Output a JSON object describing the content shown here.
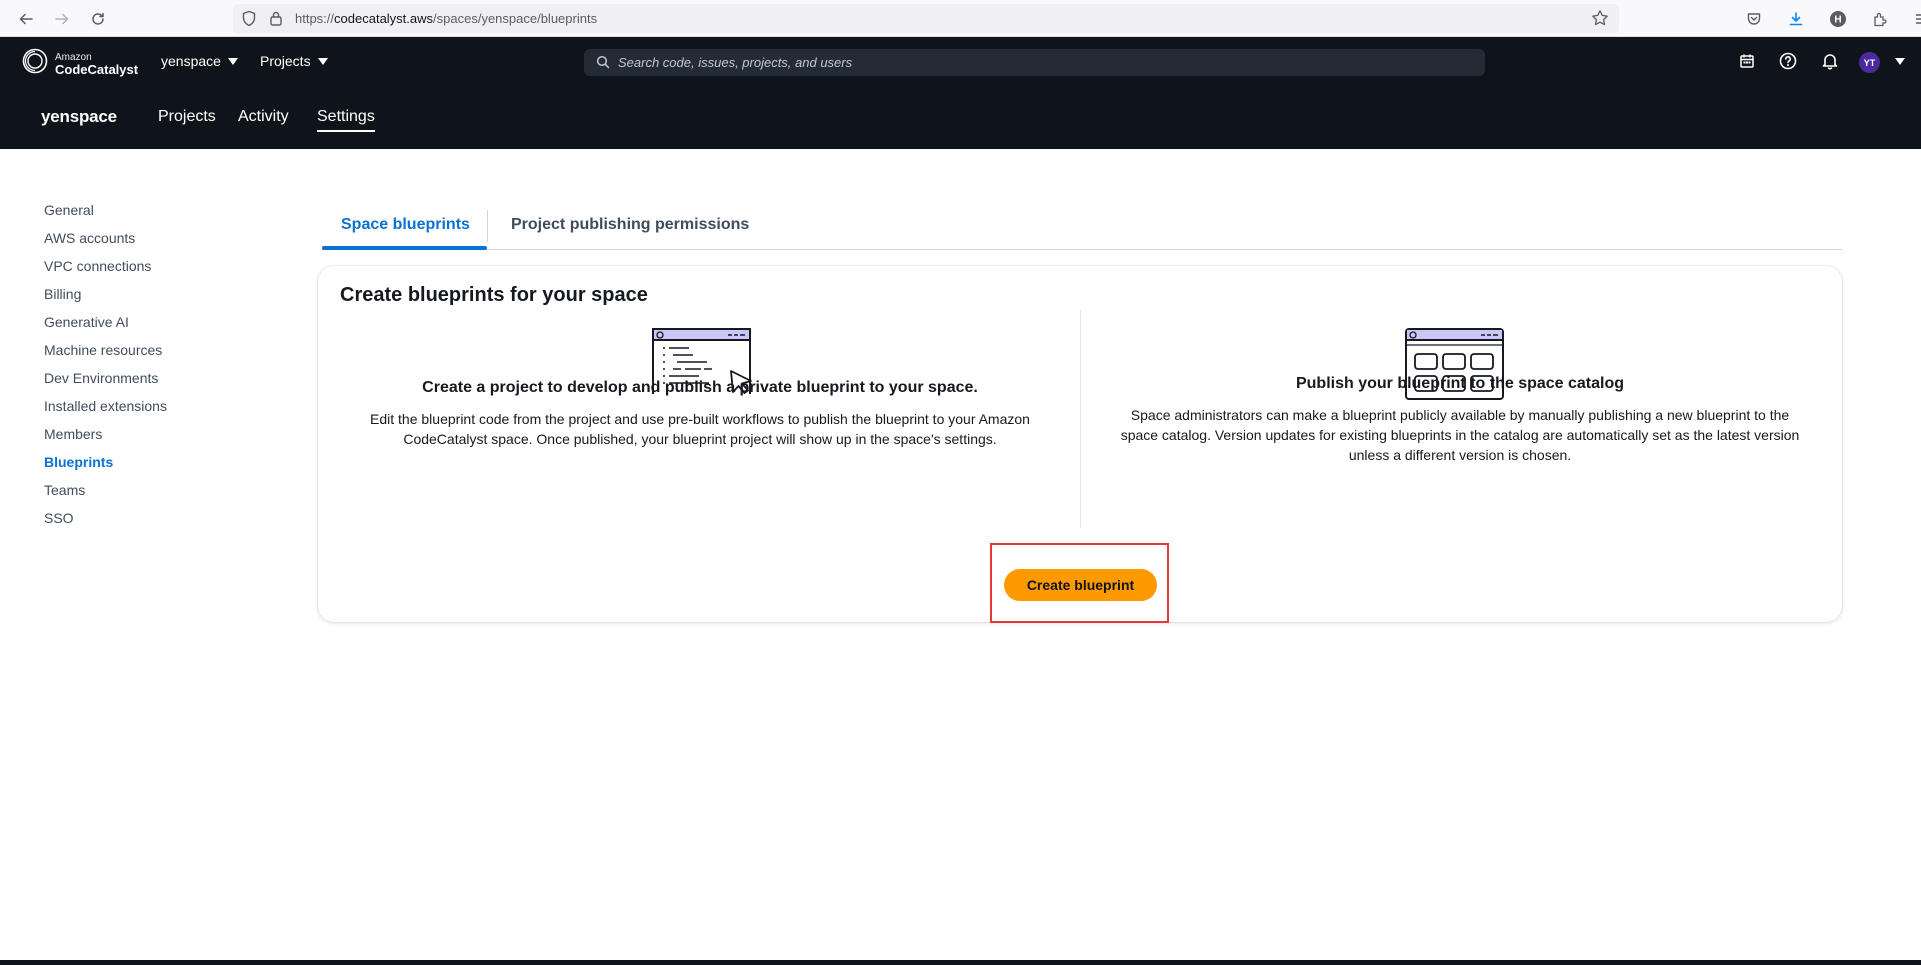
{
  "browser": {
    "url_prefix": "https://",
    "url_host": "codecatalyst.aws",
    "url_path": "/spaces/yenspace/blueprints"
  },
  "app": {
    "logo_small": "Amazon",
    "logo_big": "CodeCatalyst",
    "space_dropdown": "yenspace",
    "projects_dropdown": "Projects",
    "search_placeholder": "Search code, issues, projects, and users",
    "avatar_initials": "YT"
  },
  "space_nav": {
    "name": "yenspace",
    "links": [
      "Projects",
      "Activity",
      "Settings"
    ],
    "active": "Settings"
  },
  "sidebar": {
    "items": [
      {
        "label": "General"
      },
      {
        "label": "AWS accounts"
      },
      {
        "label": "VPC connections"
      },
      {
        "label": "Billing"
      },
      {
        "label": "Generative AI"
      },
      {
        "label": "Machine resources"
      },
      {
        "label": "Dev Environments"
      },
      {
        "label": "Installed extensions"
      },
      {
        "label": "Members"
      },
      {
        "label": "Blueprints"
      },
      {
        "label": "Teams"
      },
      {
        "label": "SSO"
      }
    ],
    "active": "Blueprints"
  },
  "tabs": {
    "items": [
      "Space blueprints",
      "Project publishing permissions"
    ],
    "active": "Space blueprints"
  },
  "card": {
    "title": "Create blueprints for your space",
    "left": {
      "heading": "Create a project to develop and publish a private blueprint to your space.",
      "body_line1": "Edit the blueprint code from the project and use pre-built workflows to publish the blueprint to your Amazon",
      "body_line2": "CodeCatalyst space. Once published, your blueprint project will show up in the space's settings."
    },
    "right": {
      "heading": "Publish your blueprint to the space catalog",
      "body_line1": "Space administrators can make a blueprint publicly available by manually publishing a new blueprint to the",
      "body_line2": "space catalog. Version updates for existing blueprints in the catalog are automatically set as the latest version",
      "body_line3": "unless a different version is chosen."
    },
    "create_button": "Create blueprint"
  },
  "colors": {
    "accent": "#0972d3",
    "primary_button": "#ff9900",
    "header_bg": "#0f141a",
    "highlight_box": "#e53935",
    "avatar_bg": "#4b2a9e"
  },
  "icons": [
    "back-icon",
    "forward-icon",
    "reload-icon",
    "shield-icon",
    "lock-icon",
    "bookmark-star-icon",
    "pocket-icon",
    "download-icon",
    "profile-h-icon",
    "extensions-icon",
    "menu-icon",
    "codecatalyst-logo-icon",
    "search-icon",
    "calendar-icon",
    "help-icon",
    "notifications-bell-icon"
  ]
}
